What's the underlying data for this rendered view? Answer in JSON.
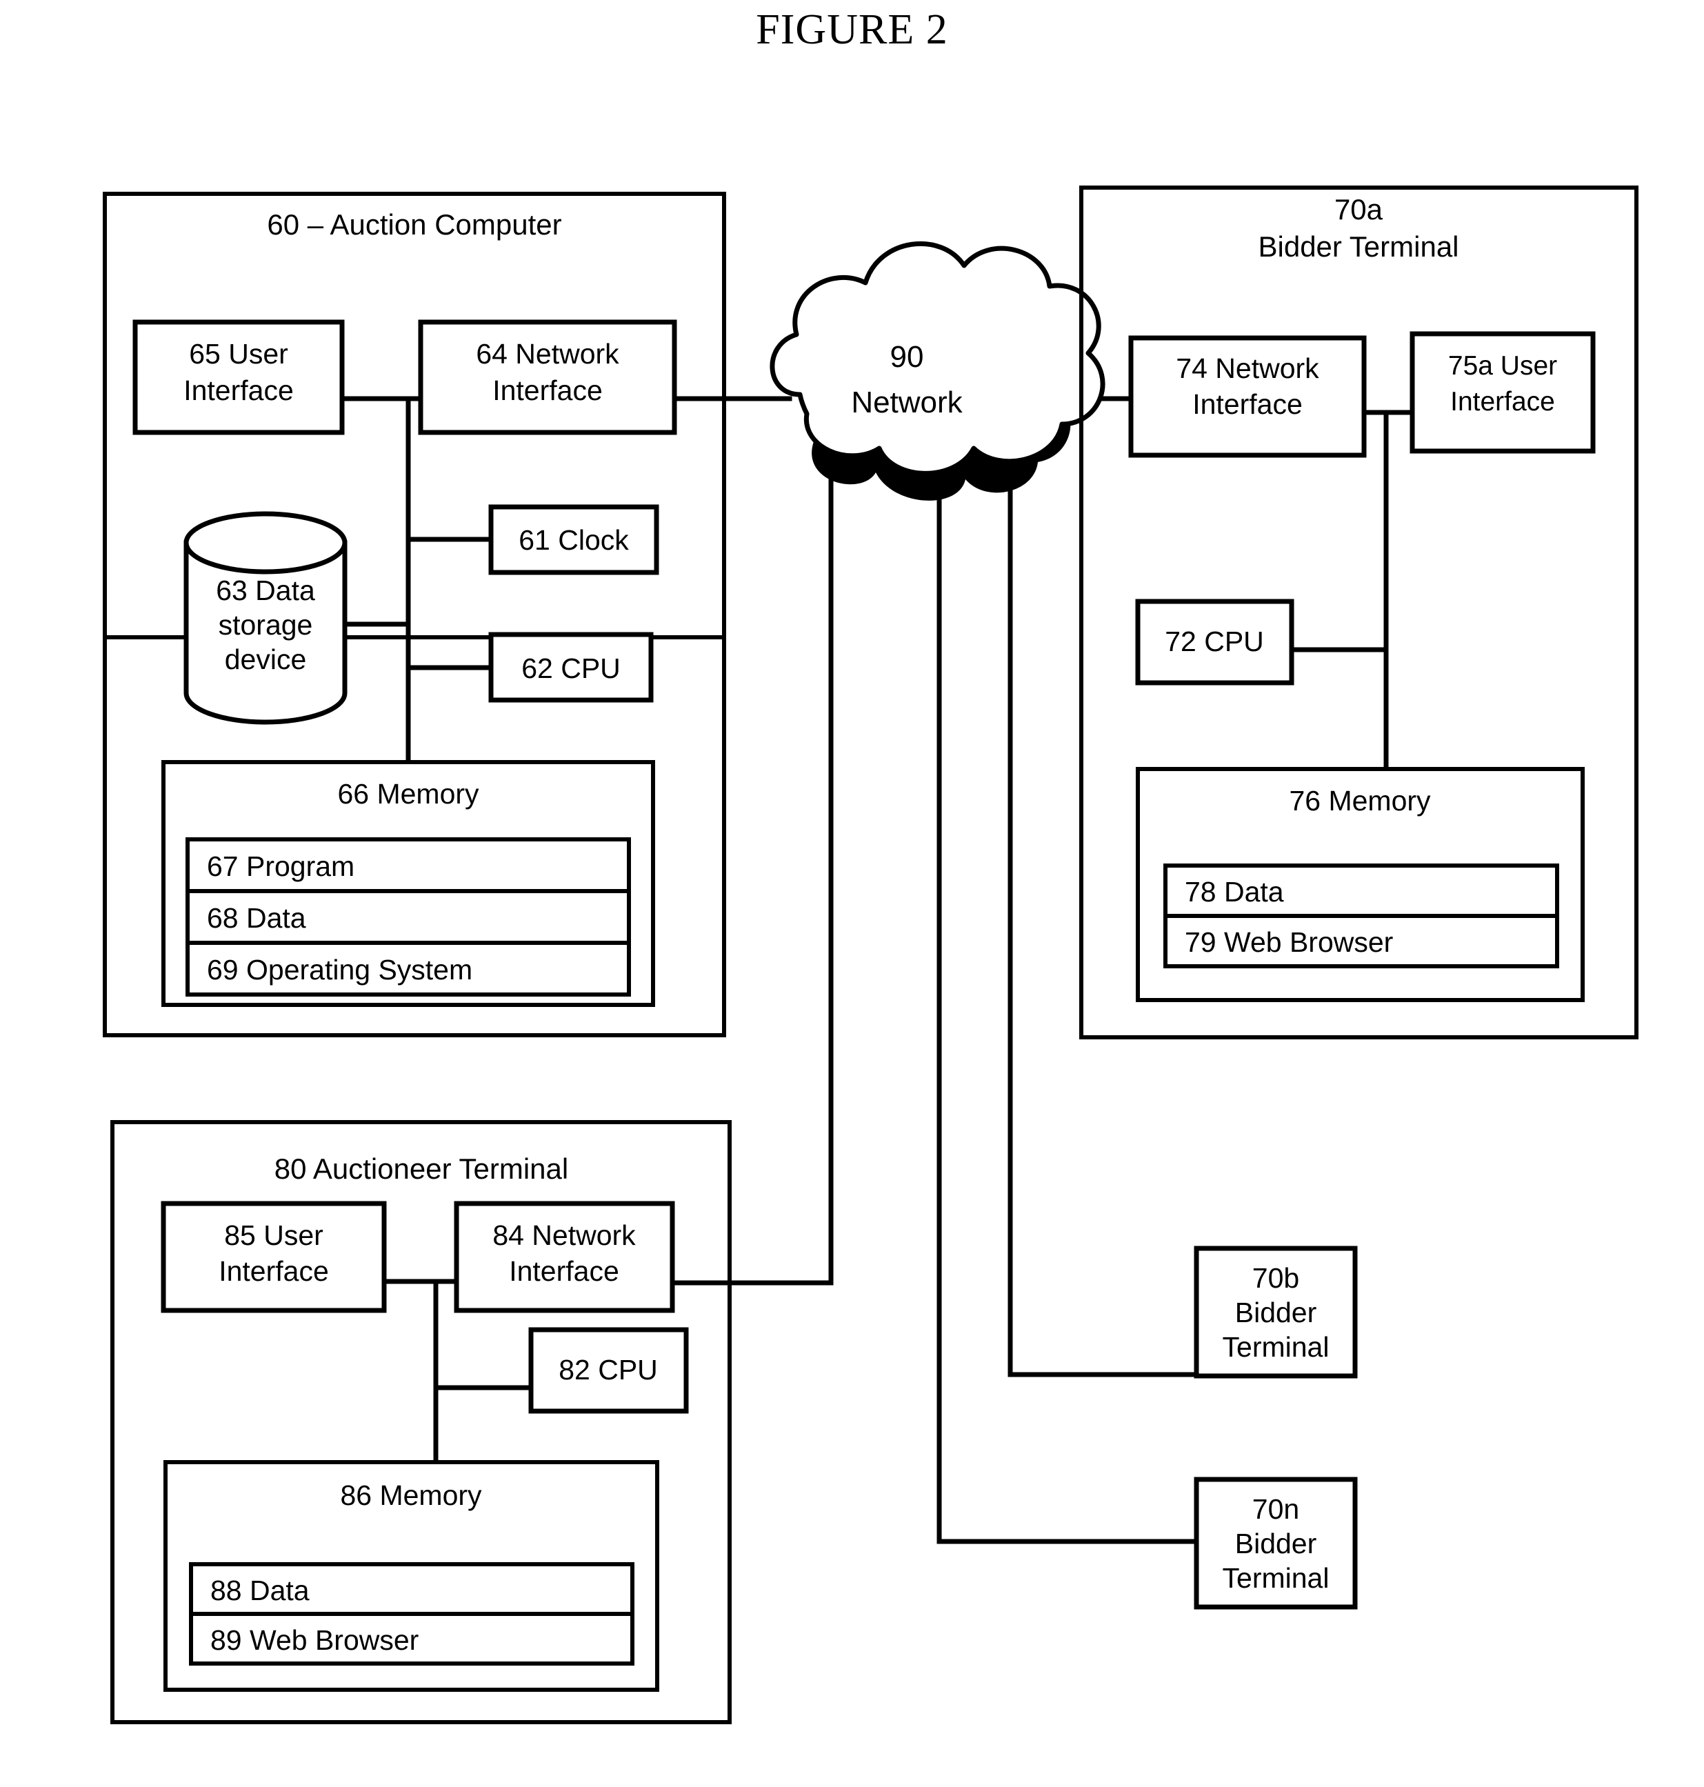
{
  "figure": {
    "title": "FIGURE 2"
  },
  "auction_computer": {
    "title": "60 – Auction Computer",
    "user_interface": "65  User\nInterface",
    "user_interface_line1": "65  User",
    "user_interface_line2": "Interface",
    "network_interface_line1": "64  Network",
    "network_interface_line2": "Interface",
    "clock": "61  Clock",
    "cpu": "62  CPU",
    "data_storage_line1": "63  Data",
    "data_storage_line2": "storage",
    "data_storage_line3": "device",
    "memory_title": "66  Memory",
    "memory_rows": [
      "67  Program",
      "68  Data",
      "69  Operating System"
    ]
  },
  "network": {
    "label_line1": "90",
    "label_line2": "Network"
  },
  "bidder_terminal_a": {
    "title_line1": "70a",
    "title_line2": "Bidder Terminal",
    "network_interface_line1": "74  Network",
    "network_interface_line2": "Interface",
    "user_interface_line1": "75a  User",
    "user_interface_line2": "Interface",
    "cpu": "72 CPU",
    "memory_title": "76 Memory",
    "memory_rows": [
      "78  Data",
      "79  Web Browser"
    ]
  },
  "auctioneer_terminal": {
    "title": "80  Auctioneer Terminal",
    "user_interface_line1": "85 User",
    "user_interface_line2": "Interface",
    "network_interface_line1": "84 Network",
    "network_interface_line2": "Interface",
    "cpu": "82 CPU",
    "memory_title": "86 Memory",
    "memory_rows": [
      "88  Data",
      "89  Web Browser"
    ]
  },
  "bidder_terminal_b": {
    "line1": "70b",
    "line2": "Bidder",
    "line3": "Terminal"
  },
  "bidder_terminal_n": {
    "line1": "70n",
    "line2": "Bidder",
    "line3": "Terminal"
  },
  "colors": {
    "ink": "#000000",
    "paper": "#ffffff"
  }
}
